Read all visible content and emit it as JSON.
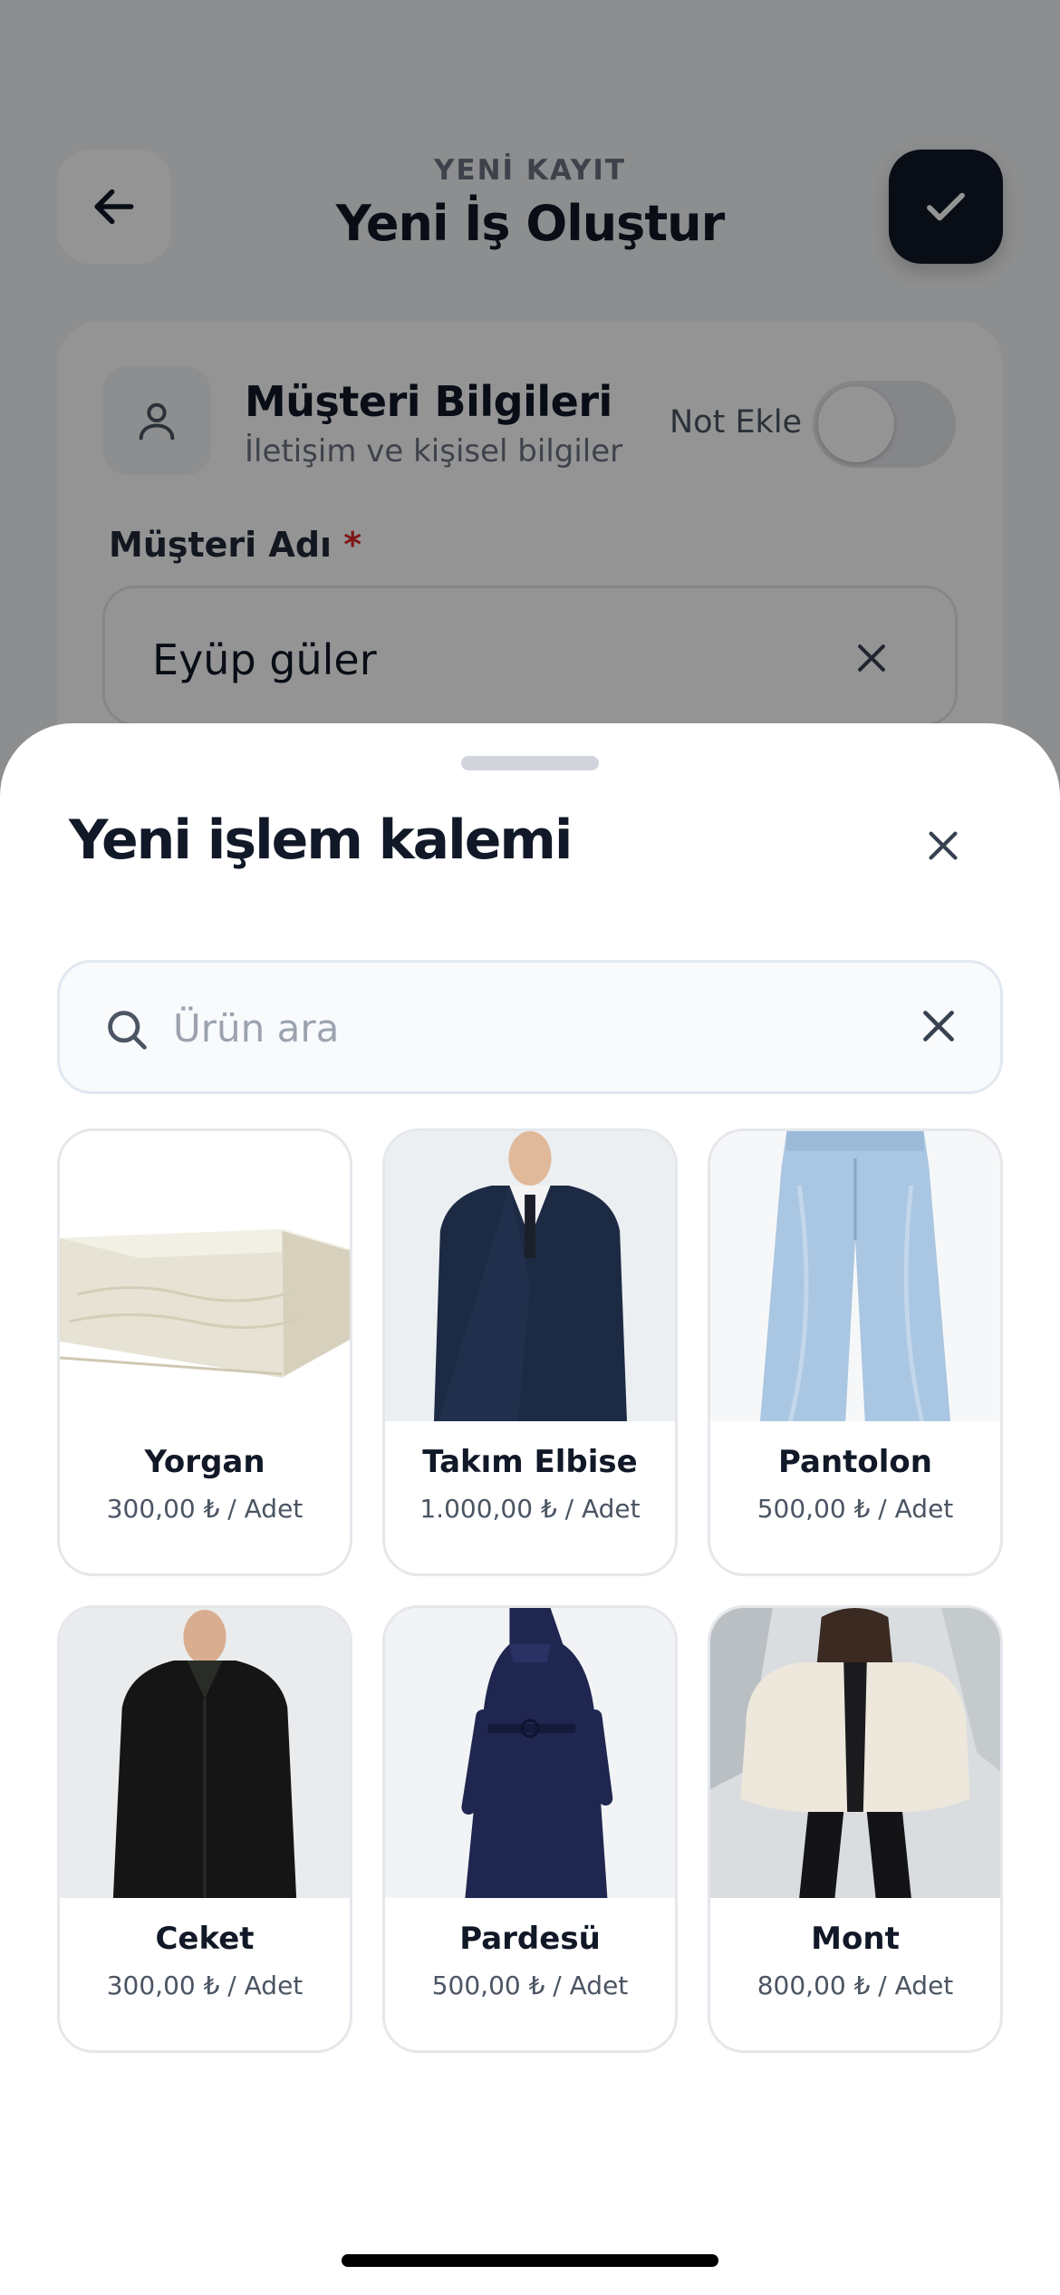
{
  "header": {
    "overline": "YENİ KAYIT",
    "title": "Yeni İş Oluştur",
    "back_icon": "arrow-left-icon",
    "confirm_icon": "check-icon"
  },
  "customer_card": {
    "title": "Müşteri Bilgileri",
    "subtitle": "İletişim ve kişisel bilgiler",
    "note_label": "Not Ekle",
    "note_toggle_on": false,
    "name_label": "Müşteri Adı",
    "required_mark": "*",
    "name_value": "Eyüp güler"
  },
  "sheet": {
    "title": "Yeni işlem kalemi",
    "search_placeholder": "Ürün ara",
    "products": [
      {
        "name": "Yorgan",
        "price": "300,00 ₺ / Adet"
      },
      {
        "name": "Takım Elbise",
        "price": "1.000,00 ₺ / Adet"
      },
      {
        "name": "Pantolon",
        "price": "500,00 ₺ / Adet"
      },
      {
        "name": "Ceket",
        "price": "300,00 ₺ / Adet"
      },
      {
        "name": "Pardesü",
        "price": "500,00 ₺ / Adet"
      },
      {
        "name": "Mont",
        "price": "800,00 ₺ / Adet"
      }
    ]
  },
  "colors": {
    "primary_dark": "#111827",
    "required": "#dc2626",
    "muted_text": "#6b7280"
  }
}
